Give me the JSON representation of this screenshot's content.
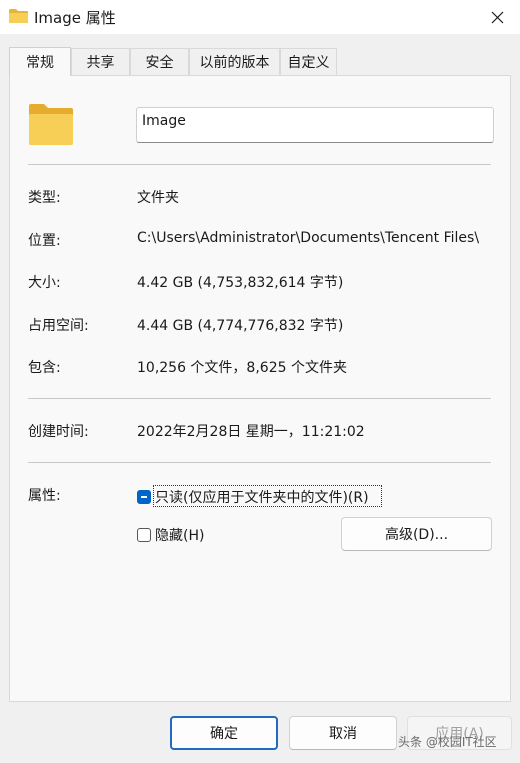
{
  "window": {
    "title": "Image 属性",
    "close_glyph": "✕",
    "icon": "folder-icon"
  },
  "tabs": [
    {
      "label": "常规",
      "active": true
    },
    {
      "label": "共享",
      "active": false
    },
    {
      "label": "安全",
      "active": false
    },
    {
      "label": "以前的版本",
      "active": false
    },
    {
      "label": "自定义",
      "active": false
    }
  ],
  "general": {
    "folder_name": "Image",
    "rows": [
      {
        "label": "类型:",
        "value": "文件夹"
      },
      {
        "label": "位置:",
        "value": "C:\\Users\\Administrator\\Documents\\Tencent Files\\"
      },
      {
        "label": "大小:",
        "value": "4.42 GB (4,753,832,614 字节)"
      },
      {
        "label": "占用空间:",
        "value": "4.44 GB (4,774,776,832 字节)"
      },
      {
        "label": "包含:",
        "value": "10,256 个文件，8,625 个文件夹"
      },
      {
        "label": "创建时间:",
        "value": "2022年2月28日 星期一，11:21:02"
      }
    ],
    "attributes": {
      "label": "属性:",
      "readonly": {
        "label": "只读(仅应用于文件夹中的文件)(R)",
        "state": "mixed"
      },
      "hidden": {
        "label": "隐藏(H)",
        "state": "unchecked"
      },
      "advanced_label": "高级(D)..."
    }
  },
  "footer": {
    "ok": "确定",
    "cancel": "取消",
    "apply": "应用(A)"
  },
  "watermark": "头条 @校园IT社区",
  "colors": {
    "folder": "#f4c84a",
    "accent": "#0064c8",
    "primary_border": "#1f6bbf"
  }
}
